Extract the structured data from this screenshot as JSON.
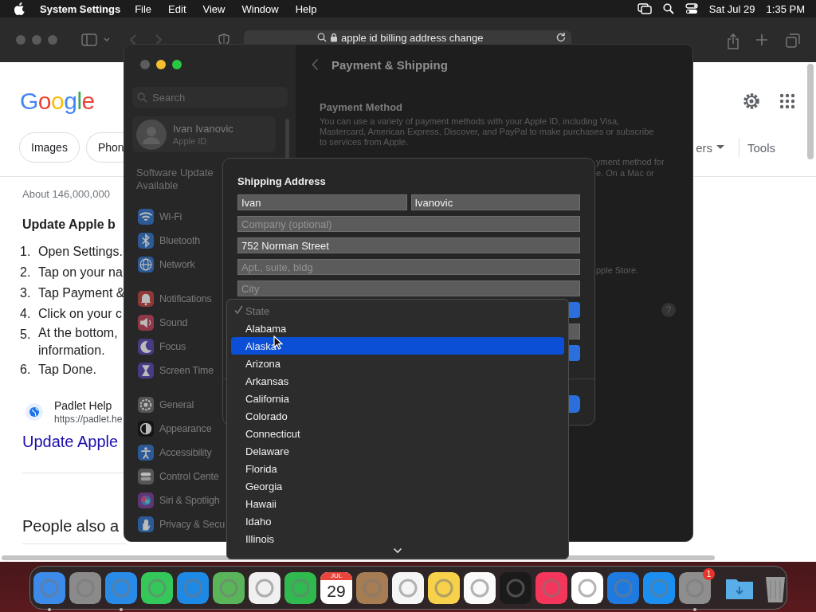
{
  "menu_bar": {
    "app_name": "System Settings",
    "menus": [
      "File",
      "Edit",
      "View",
      "Window",
      "Help"
    ],
    "date": "Sat Jul 29",
    "time": "1:35 PM"
  },
  "browser": {
    "address": "apple id billing address change",
    "page": {
      "logo": "Google",
      "chips": [
        "Images",
        "Phon"
      ],
      "filter": "ers",
      "tools": "Tools",
      "result_count": "About 146,000,000",
      "snippet_title": "Update Apple b",
      "steps": [
        {
          "number": "1.",
          "lines": [
            "Open Settings."
          ]
        },
        {
          "number": "2.",
          "lines": [
            "Tap on your na"
          ]
        },
        {
          "number": "3.",
          "lines": [
            "Tap Payment &"
          ]
        },
        {
          "number": "4.",
          "lines": [
            "Click on your c"
          ]
        },
        {
          "number": "5.",
          "lines": [
            "At the bottom,",
            "information."
          ]
        },
        {
          "number": "6.",
          "lines": [
            "Tap Done."
          ]
        }
      ],
      "source": {
        "name": "Padlet Help",
        "url": "https://padlet.he"
      },
      "result_link": "Update Apple",
      "people_also": "People also a"
    }
  },
  "settings": {
    "search_placeholder": "Search",
    "account": {
      "name": "Ivan Ivanovic",
      "subtitle": "Apple ID"
    },
    "update_notice": "Software Update Available",
    "sidebar_groups": [
      [
        {
          "label": "Wi-Fi",
          "color": "#2b5a96"
        },
        {
          "label": "Bluetooth",
          "color": "#2b5a96"
        },
        {
          "label": "Network",
          "color": "#2b5a96"
        }
      ],
      [
        {
          "label": "Notifications",
          "color": "#8f3838"
        },
        {
          "label": "Sound",
          "color": "#8f3848"
        },
        {
          "label": "Focus",
          "color": "#463c86"
        },
        {
          "label": "Screen Time",
          "color": "#463c86"
        }
      ],
      [
        {
          "label": "General",
          "color": "#565656"
        },
        {
          "label": "Appearance",
          "color": "#151515"
        },
        {
          "label": "Accessibility",
          "color": "#2b5a96"
        },
        {
          "label": "Control Cente",
          "color": "#565656"
        },
        {
          "label": "Siri & Spotligh",
          "color": "#5e3672"
        },
        {
          "label": "Privacy & Secu",
          "color": "#2b5a96"
        }
      ]
    ],
    "title": "Payment & Shipping",
    "section_title": "Payment Method",
    "description": "You can use a variety of payment methods with your Apple ID, including Visa, Mastercard, American Express, Discover, and PayPal to make purchases or subscribe to services from Apple.",
    "right_fragments": [
      [
        "yment method for",
        "e. On a Mac or"
      ],
      [
        "pple Store."
      ]
    ],
    "help": "?",
    "sheet": {
      "title": "Shipping Address",
      "rows": [
        [
          {
            "value": "Ivan"
          },
          {
            "value": "Ivanovic"
          }
        ],
        [
          {
            "placeholder": "Company (optional)"
          }
        ],
        [
          {
            "value": "752 Norman Street"
          }
        ],
        [
          {
            "placeholder": "Apt., suite, bldg"
          }
        ],
        [
          {
            "placeholder": "City"
          }
        ]
      ]
    }
  },
  "state_menu": {
    "items": [
      {
        "label": "State",
        "checked": true,
        "disabled": true,
        "selected": false
      },
      {
        "label": "Alabama",
        "checked": false,
        "disabled": false,
        "selected": false
      },
      {
        "label": "Alaska",
        "checked": false,
        "disabled": false,
        "selected": true
      },
      {
        "label": "Arizona",
        "checked": false,
        "disabled": false,
        "selected": false
      },
      {
        "label": "Arkansas",
        "checked": false,
        "disabled": false,
        "selected": false
      },
      {
        "label": "California",
        "checked": false,
        "disabled": false,
        "selected": false
      },
      {
        "label": "Colorado",
        "checked": false,
        "disabled": false,
        "selected": false
      },
      {
        "label": "Connecticut",
        "checked": false,
        "disabled": false,
        "selected": false
      },
      {
        "label": "Delaware",
        "checked": false,
        "disabled": false,
        "selected": false
      },
      {
        "label": "Florida",
        "checked": false,
        "disabled": false,
        "selected": false
      },
      {
        "label": "Georgia",
        "checked": false,
        "disabled": false,
        "selected": false
      },
      {
        "label": "Hawaii",
        "checked": false,
        "disabled": false,
        "selected": false
      },
      {
        "label": "Idaho",
        "checked": false,
        "disabled": false,
        "selected": false
      },
      {
        "label": "Illinois",
        "checked": false,
        "disabled": false,
        "selected": false
      }
    ]
  },
  "dock": {
    "items": [
      {
        "kind": "app",
        "color": "#3d8be8",
        "running": true
      },
      {
        "kind": "app",
        "color": "#8a8a8a",
        "running": false
      },
      {
        "kind": "app",
        "color": "#2a8be6",
        "running": true
      },
      {
        "kind": "app",
        "color": "#34c759",
        "running": false
      },
      {
        "kind": "app",
        "color": "#1e88e5",
        "running": false
      },
      {
        "kind": "app",
        "color": "#5ab55a",
        "running": false
      },
      {
        "kind": "app",
        "color": "#f0f0f0",
        "running": false
      },
      {
        "kind": "app",
        "color": "#30b94f",
        "running": false
      },
      {
        "kind": "calendar",
        "color": "#ffffff",
        "running": false,
        "month": "JUL",
        "day": "29"
      },
      {
        "kind": "app",
        "color": "#a67c52",
        "running": false
      },
      {
        "kind": "app",
        "color": "#f5f5f5",
        "running": false
      },
      {
        "kind": "app",
        "color": "#f8d14a",
        "running": false
      },
      {
        "kind": "app",
        "color": "#fafafa",
        "running": false
      },
      {
        "kind": "app",
        "color": "#1a1a1a",
        "running": false
      },
      {
        "kind": "app",
        "color": "#f5365c",
        "running": false
      },
      {
        "kind": "app",
        "color": "#ffffff",
        "running": false
      },
      {
        "kind": "app",
        "color": "#1f7ae0",
        "running": false
      },
      {
        "kind": "app",
        "color": "#1b8ef0",
        "running": false
      },
      {
        "kind": "app",
        "color": "#8e8e8e",
        "running": true,
        "badge": "1"
      },
      {
        "kind": "folder",
        "color": "#5aaee8",
        "running": false
      },
      {
        "kind": "trash",
        "color": "#9a9a9a",
        "running": false
      }
    ]
  }
}
